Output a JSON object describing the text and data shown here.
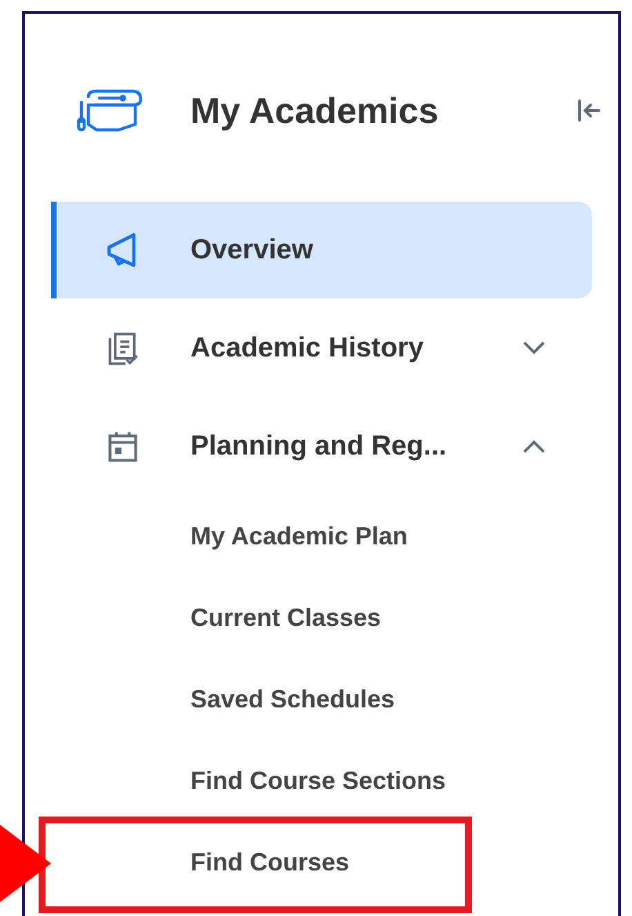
{
  "header": {
    "title": "My Academics"
  },
  "nav": [
    {
      "kind": "link",
      "label": "Overview",
      "selected": true
    },
    {
      "kind": "group",
      "label": "Academic History",
      "selected": false,
      "expanded": false
    },
    {
      "kind": "group",
      "label": "Planning and Reg...",
      "selected": false,
      "expanded": true,
      "children": [
        {
          "label": "My Academic Plan",
          "highlighted": false
        },
        {
          "label": "Current Classes",
          "highlighted": false
        },
        {
          "label": "Saved Schedules",
          "highlighted": false
        },
        {
          "label": "Find Course Sections",
          "highlighted": false
        },
        {
          "label": "Find Courses",
          "highlighted": true
        }
      ]
    }
  ]
}
